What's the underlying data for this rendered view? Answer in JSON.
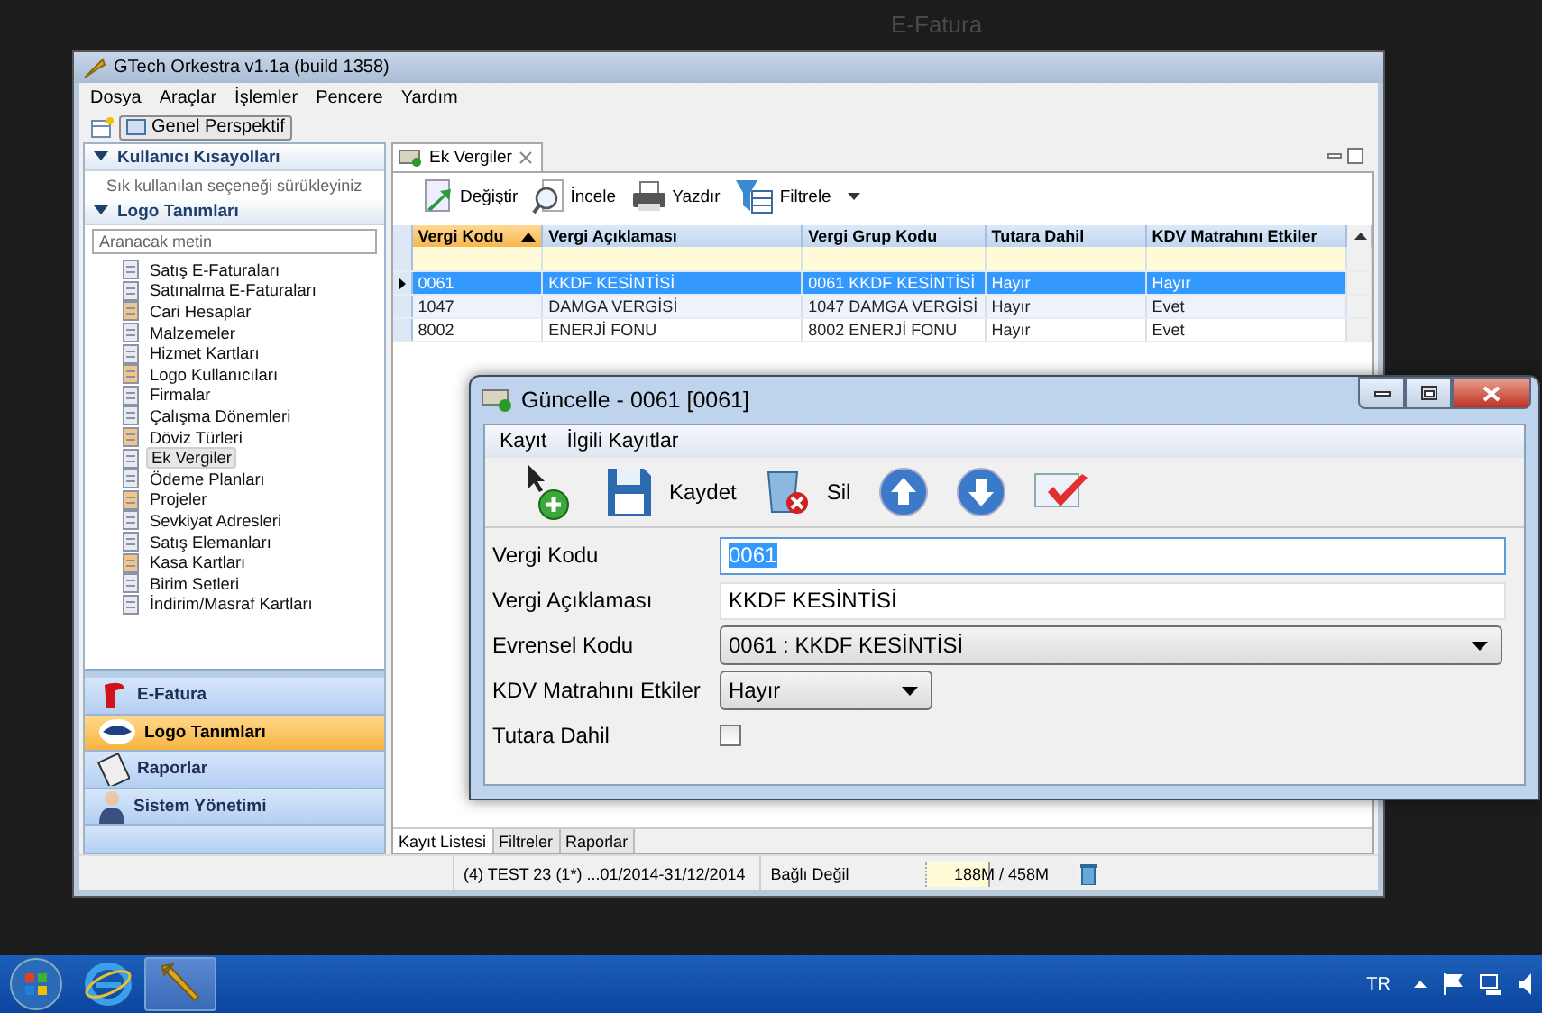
{
  "desktop": {
    "background_text": "E-Fatura"
  },
  "main_window": {
    "title": "GTech Orkestra v1.1a (build 1358)",
    "menu": [
      "Dosya",
      "Araçlar",
      "İşlemler",
      "Pencere",
      "Yardım"
    ],
    "perspective": "Genel Perspektif",
    "sidebar": {
      "shortcuts": {
        "title": "Kullanıcı Kısayolları",
        "expanded": true,
        "hint": "Sık kullanılan seçeneği sürükleyiniz"
      },
      "definitions": {
        "title": "Logo Tanımları",
        "expanded": true,
        "search_placeholder": "Aranacak metin",
        "items": [
          {
            "label": "Satış E-Faturaları",
            "selected": false
          },
          {
            "label": "Satınalma E-Faturaları",
            "selected": false
          },
          {
            "label": "Cari Hesaplar",
            "selected": false
          },
          {
            "label": "Malzemeler",
            "selected": false
          },
          {
            "label": "Hizmet Kartları",
            "selected": false
          },
          {
            "label": "Logo Kullanıcıları",
            "selected": false
          },
          {
            "label": "Firmalar",
            "selected": false
          },
          {
            "label": "Çalışma Dönemleri",
            "selected": false
          },
          {
            "label": "Döviz Türleri",
            "selected": false
          },
          {
            "label": "Ek Vergiler",
            "selected": true
          },
          {
            "label": "Ödeme Planları",
            "selected": false
          },
          {
            "label": "Projeler",
            "selected": false
          },
          {
            "label": "Sevkiyat Adresleri",
            "selected": false
          },
          {
            "label": "Satış Elemanları",
            "selected": false
          },
          {
            "label": "Kasa Kartları",
            "selected": false
          },
          {
            "label": "Birim Setleri",
            "selected": false
          },
          {
            "label": "İndirim/Masraf Kartları",
            "selected": false
          }
        ]
      },
      "nav": [
        {
          "kind": "efatura",
          "label": "E-Fatura",
          "selected": false
        },
        {
          "kind": "logo",
          "label": "Logo Tanımları",
          "selected": true
        },
        {
          "kind": "reports",
          "label": "Raporlar",
          "selected": false
        },
        {
          "kind": "admin",
          "label": "Sistem Yönetimi",
          "selected": false
        }
      ]
    },
    "panel": {
      "tab": "Ek Vergiler",
      "toolbar": [
        {
          "kind": "edit",
          "label": "Değiştir"
        },
        {
          "kind": "inspect",
          "label": "İncele"
        },
        {
          "kind": "print",
          "label": "Yazdır"
        },
        {
          "kind": "filter",
          "label": "Filtrele"
        }
      ],
      "grid": {
        "columns": [
          {
            "label": "Vergi Kodu",
            "sorted": true
          },
          {
            "label": "Vergi Açıklaması",
            "sorted": false
          },
          {
            "label": "Vergi Grup Kodu",
            "sorted": false
          },
          {
            "label": "Tutara Dahil",
            "sorted": false
          },
          {
            "label": "KDV Matrahını Etkiler",
            "sorted": false
          }
        ],
        "rows": [
          {
            "cells": [
              "0061",
              "KKDF KESİNTİSİ",
              "0061 KKDF KESİNTİSİ",
              "Hayır",
              "Hayır"
            ],
            "selected": true
          },
          {
            "cells": [
              "1047",
              "DAMGA VERGİSİ",
              "1047 DAMGA VERGİSİ",
              "Hayır",
              "Evet"
            ],
            "selected": false
          },
          {
            "cells": [
              "8002",
              "ENERJİ FONU",
              "8002 ENERJİ FONU",
              "Hayır",
              "Evet"
            ],
            "selected": false
          }
        ]
      },
      "bottom_tabs": [
        {
          "label": "Kayıt Listesi",
          "selected": true
        },
        {
          "label": "Filtreler",
          "selected": false
        },
        {
          "label": "Raporlar",
          "selected": false
        }
      ]
    },
    "status_bar": {
      "company": "(4) TEST 23  (1*) ...01/2014-31/12/2014",
      "connection": "Bağlı Değil",
      "memory": {
        "text": "188M / 458M",
        "level": 0.41
      }
    }
  },
  "dialog": {
    "title": "Güncelle - 0061 [0061]",
    "menu": [
      "Kayıt",
      "İlgili Kayıtlar"
    ],
    "toolbar": [
      {
        "kind": "add"
      },
      {
        "kind": "save",
        "label": "Kaydet"
      },
      {
        "kind": "delete",
        "label": "Sil"
      },
      {
        "kind": "up"
      },
      {
        "kind": "down"
      },
      {
        "kind": "approve"
      }
    ],
    "fields": [
      {
        "kind": "text",
        "label": "Vergi Kodu",
        "value": "0061",
        "focused": true
      },
      {
        "kind": "text",
        "label": "Vergi Açıklaması",
        "value": "KKDF KESİNTİSİ",
        "focused": false
      },
      {
        "kind": "dropdown",
        "label": "Evrensel Kodu",
        "value": "0061 : KKDF KESİNTİSİ",
        "wide": true
      },
      {
        "kind": "dropdown",
        "label": "KDV Matrahını Etkiler",
        "value": "Hayır",
        "wide": false
      },
      {
        "kind": "checkbox",
        "label": "Tutara Dahil",
        "checked": false
      }
    ]
  },
  "taskbar": {
    "language": "TR"
  }
}
